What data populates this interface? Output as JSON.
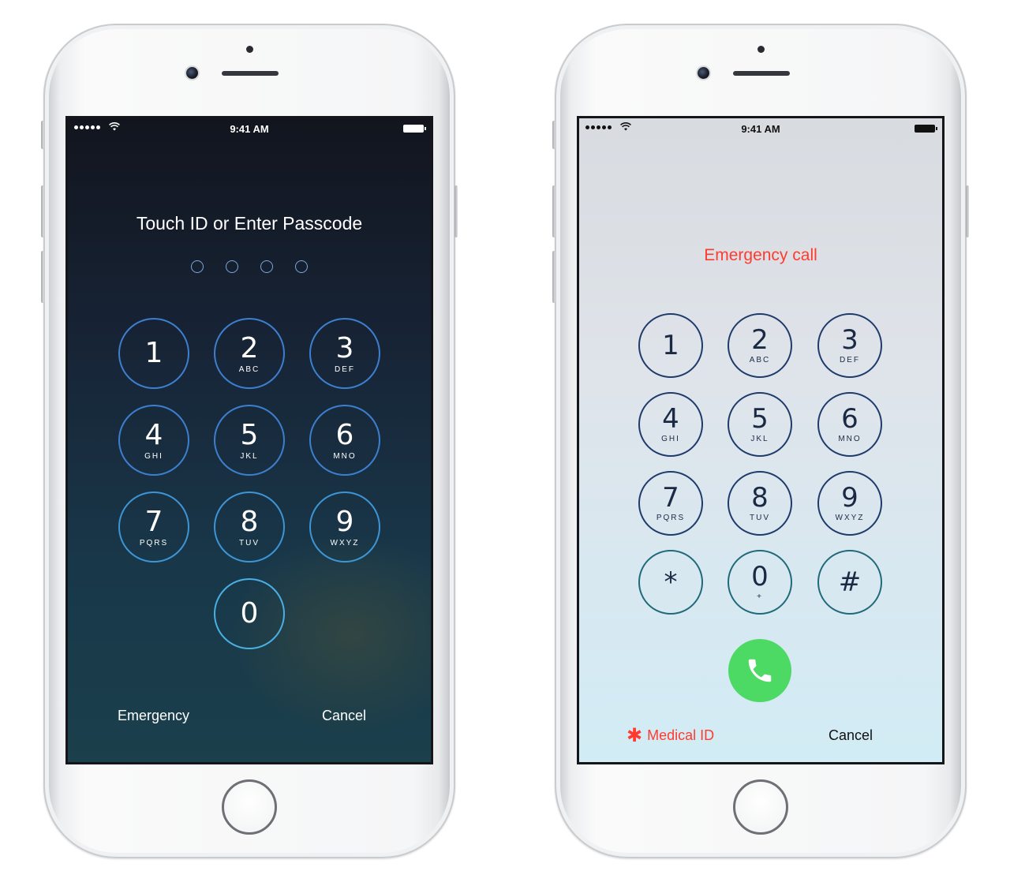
{
  "left_phone": {
    "status_bar": {
      "time": "9:41 AM"
    },
    "title": "Touch ID or Enter Passcode",
    "passcode_length": 4,
    "keypad": [
      {
        "digit": "1",
        "letters": ""
      },
      {
        "digit": "2",
        "letters": "ABC"
      },
      {
        "digit": "3",
        "letters": "DEF"
      },
      {
        "digit": "4",
        "letters": "GHI"
      },
      {
        "digit": "5",
        "letters": "JKL"
      },
      {
        "digit": "6",
        "letters": "MNO"
      },
      {
        "digit": "7",
        "letters": "PQRS"
      },
      {
        "digit": "8",
        "letters": "TUV"
      },
      {
        "digit": "9",
        "letters": "WXYZ"
      },
      {
        "digit": "0",
        "letters": ""
      }
    ],
    "emergency_label": "Emergency",
    "cancel_label": "Cancel"
  },
  "right_phone": {
    "status_bar": {
      "time": "9:41 AM"
    },
    "title": "Emergency call",
    "keypad": [
      {
        "digit": "1",
        "letters": ""
      },
      {
        "digit": "2",
        "letters": "ABC"
      },
      {
        "digit": "3",
        "letters": "DEF"
      },
      {
        "digit": "4",
        "letters": "GHI"
      },
      {
        "digit": "5",
        "letters": "JKL"
      },
      {
        "digit": "6",
        "letters": "MNO"
      },
      {
        "digit": "7",
        "letters": "PQRS"
      },
      {
        "digit": "8",
        "letters": "TUV"
      },
      {
        "digit": "9",
        "letters": "WXYZ"
      },
      {
        "digit": "*",
        "letters": ""
      },
      {
        "digit": "0",
        "letters": "+"
      },
      {
        "digit": "#",
        "letters": ""
      }
    ],
    "call_icon": "phone-icon",
    "medical_id_asterisk": "✱",
    "medical_id_label": "Medical ID",
    "cancel_label": "Cancel"
  },
  "colors": {
    "accent_red": "#ff3b30",
    "call_green": "#4cd964",
    "lock_key_ring": "#3d7fcf",
    "dialer_key_ring": "#1f3b6b"
  }
}
